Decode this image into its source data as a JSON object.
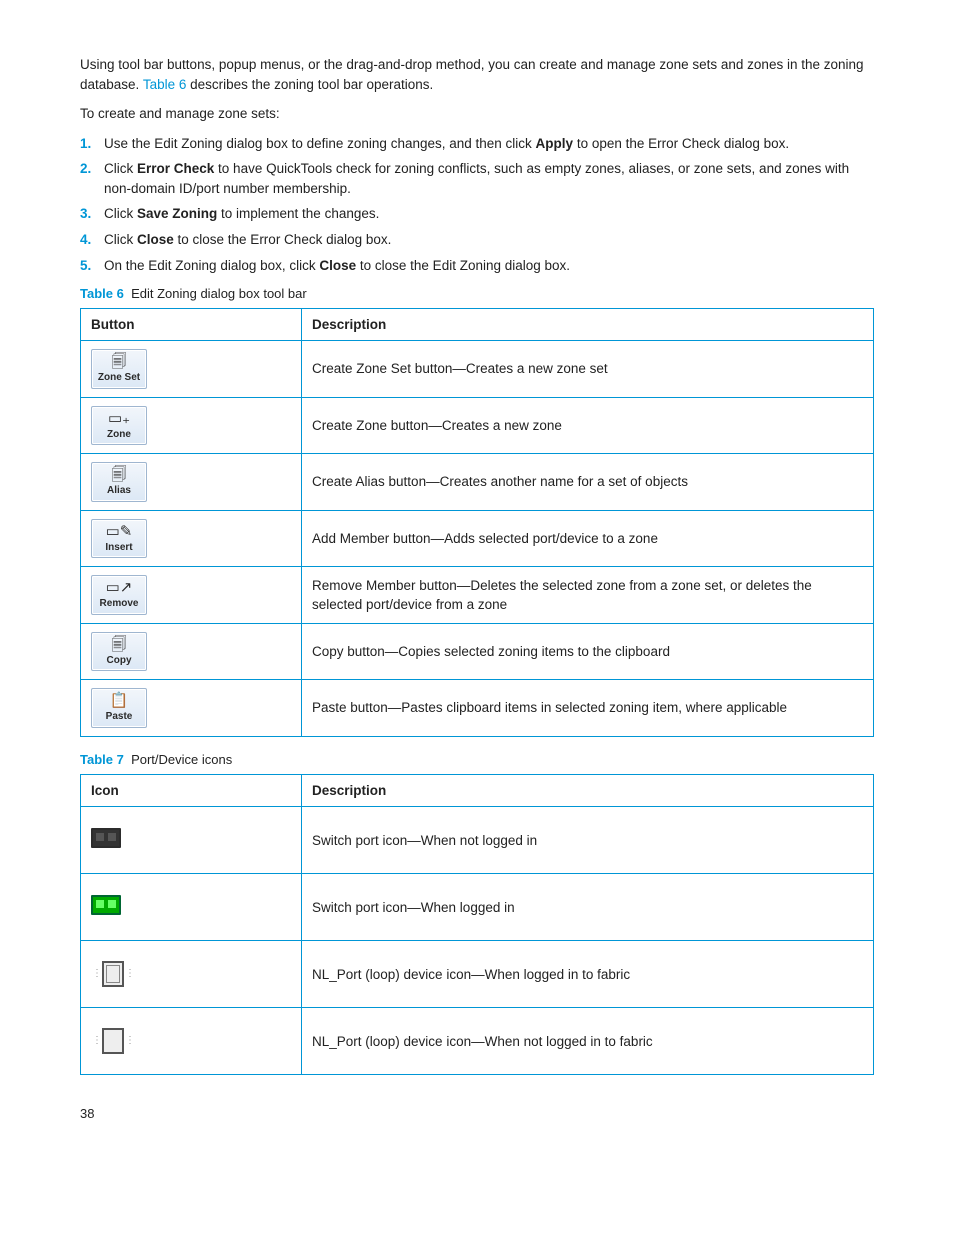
{
  "intro": {
    "p1a": "Using tool bar buttons, popup menus, or the drag-and-drop method, you can create and manage zone sets and zones in the zoning database. ",
    "link": "Table 6",
    "p1b": " describes the zoning tool bar operations.",
    "p2": "To create and manage zone sets:"
  },
  "steps": [
    {
      "n": "1.",
      "pre": "Use the Edit Zoning dialog box to define zoning changes, and then click ",
      "b": "Apply",
      "post": " to open the Error Check dialog box."
    },
    {
      "n": "2.",
      "pre": "Click ",
      "b": "Error Check",
      "post": " to have QuickTools check for zoning conflicts, such as empty zones, aliases, or zone sets, and zones with non-domain ID/port number membership."
    },
    {
      "n": "3.",
      "pre": "Click ",
      "b": "Save Zoning",
      "post": " to implement the changes."
    },
    {
      "n": "4.",
      "pre": "Click ",
      "b": "Close",
      "post": " to close the Error Check dialog box."
    },
    {
      "n": "5.",
      "pre": "On the Edit Zoning dialog box, click ",
      "b": "Close",
      "post": " to close the Edit Zoning dialog box."
    }
  ],
  "table6": {
    "label": "Table 6",
    "title": "Edit Zoning dialog box tool bar",
    "h1": "Button",
    "h2": "Description",
    "rows": [
      {
        "btn": "Zone Set",
        "glyph": "🗐",
        "desc": "Create Zone Set button—Creates a new zone set"
      },
      {
        "btn": "Zone",
        "glyph": "▭₊",
        "desc": "Create Zone button—Creates a new zone"
      },
      {
        "btn": "Alias",
        "glyph": "🗐",
        "desc": "Create Alias button—Creates another name for a set of objects"
      },
      {
        "btn": "Insert",
        "glyph": "▭✎",
        "desc": "Add Member button—Adds selected port/device to a zone"
      },
      {
        "btn": "Remove",
        "glyph": "▭↗",
        "desc": "Remove Member button—Deletes the selected zone from a zone set, or deletes the selected port/device from a zone"
      },
      {
        "btn": "Copy",
        "glyph": "🗐",
        "desc": "Copy button—Copies selected zoning items to the clipboard"
      },
      {
        "btn": "Paste",
        "glyph": "📋",
        "desc": "Paste button—Pastes clipboard items in selected zoning item, where applicable"
      }
    ]
  },
  "table7": {
    "label": "Table 7",
    "title": "Port/Device icons",
    "h1": "Icon",
    "h2": "Description",
    "rows": [
      {
        "icon": "switch-port-not-logged",
        "desc": "Switch port icon—When not logged in"
      },
      {
        "icon": "switch-port-logged",
        "desc": "Switch port icon—When logged in"
      },
      {
        "icon": "nl-port-logged",
        "desc": "NL_Port (loop) device icon—When logged in to fabric"
      },
      {
        "icon": "nl-port-not-logged",
        "desc": "NL_Port (loop) device icon—When not logged in to fabric"
      }
    ]
  },
  "pagenum": "38"
}
